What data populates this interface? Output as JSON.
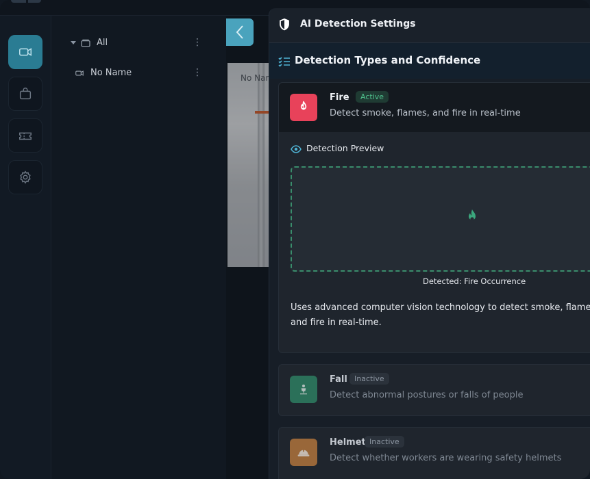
{
  "rail": {
    "items": [
      {
        "name": "camera",
        "active": true
      },
      {
        "name": "bag",
        "active": false
      },
      {
        "name": "ticket",
        "active": false
      },
      {
        "name": "settings",
        "active": false
      }
    ]
  },
  "tree": {
    "root_label": "All",
    "device_label": "No Name"
  },
  "camera": {
    "label": "No Name"
  },
  "panel": {
    "title": "AI Detection Settings",
    "section_title": "Detection Types and Confidence",
    "types": [
      {
        "name": "Fire",
        "status": "Active",
        "description": "Detect smoke, flames, and fire in real-time",
        "icon": "fire-icon",
        "color": "#e8425a",
        "preview_label": "Detection Preview",
        "preview_caption": "Detected: Fire Occurrence",
        "details": "Uses advanced computer vision technology to detect smoke, flames, and fire in real-time."
      },
      {
        "name": "Fall",
        "status": "Inactive",
        "description": "Detect abnormal postures or falls of people",
        "icon": "person-fall-icon",
        "color": "#2f8a68"
      },
      {
        "name": "Helmet",
        "status": "Inactive",
        "description": "Detect whether workers are wearing safety helmets",
        "icon": "helmet-icon",
        "color": "#c27d3d"
      }
    ]
  },
  "colors": {
    "accent": "#2a7c93",
    "active_badge": "#4fc08d",
    "preview_border": "#3a8d6c"
  }
}
